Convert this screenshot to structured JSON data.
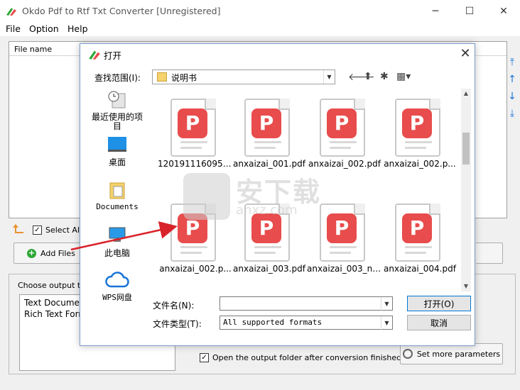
{
  "window": {
    "title": "Okdo Pdf to Rtf Txt Converter [Unregistered]",
    "minimize": "─",
    "maximize": "☐",
    "close": "✕"
  },
  "menu": {
    "file": "File",
    "option": "Option",
    "help": "Help"
  },
  "filelist": {
    "header": "File name"
  },
  "select_all": {
    "label": "Select All",
    "checked": "✓"
  },
  "add_files": {
    "label": "Add Files",
    "icon": "+"
  },
  "output": {
    "group_title": "Choose output type",
    "types": [
      "Text Document",
      "Rich Text Format"
    ]
  },
  "open_folder": {
    "label": "Open the output folder after conversion finished",
    "checked": "✓"
  },
  "set_more": {
    "label": "Set more parameters"
  },
  "dialog": {
    "title": "打开",
    "close": "✕",
    "look_in_label": "查找范围(I):",
    "look_in_value": "说明书",
    "places": [
      {
        "label": "最近使用的项目",
        "icon": "recent-icon"
      },
      {
        "label": "桌面",
        "icon": "desktop-icon"
      },
      {
        "label": "Documents",
        "icon": "documents-icon"
      },
      {
        "label": "此电脑",
        "icon": "computer-icon"
      },
      {
        "label": "WPS网盘",
        "icon": "cloud-icon"
      }
    ],
    "files": [
      "1201911160954...",
      "anxaizai_001.pdf",
      "anxaizai_002.pdf",
      "anxaizai_002.p...",
      "anxaizai_002.p...",
      "anxaizai_003.pdf",
      "anxaizai_003_ne...",
      "anxaizai_004.pdf"
    ],
    "file_glyph": "P",
    "filename_label": "文件名(N):",
    "filename_value": "",
    "filetype_label": "文件类型(T):",
    "filetype_value": "All supported formats",
    "open_button": "打开(O)",
    "cancel_button": "取消"
  },
  "watermark": {
    "cn": "安下载",
    "en": "anxz.com"
  },
  "colors": {
    "accent": "#1a73d9",
    "pdf_red": "#e84c4c",
    "green": "#2fa838"
  }
}
